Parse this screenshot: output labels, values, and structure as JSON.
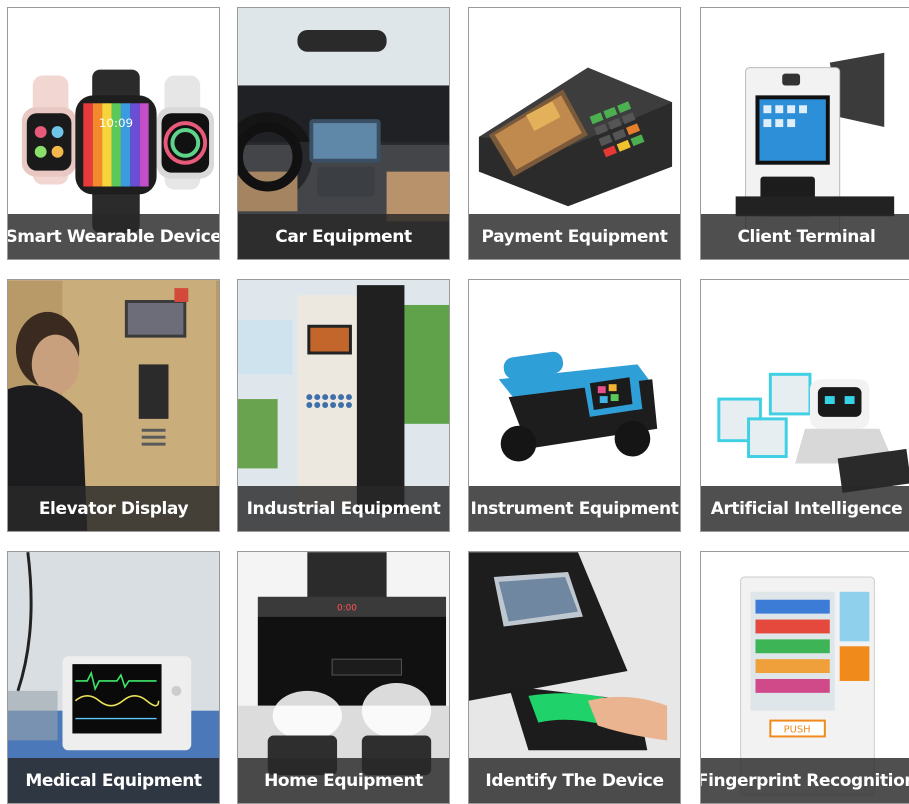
{
  "tiles": [
    {
      "label": "Smart Wearable Device",
      "icon": "smartwatch-icon"
    },
    {
      "label": "Car Equipment",
      "icon": "car-dashboard-icon"
    },
    {
      "label": "Payment Equipment",
      "icon": "pos-terminal-icon"
    },
    {
      "label": "Client Terminal",
      "icon": "kiosk-icon"
    },
    {
      "label": "Elevator Display",
      "icon": "elevator-display-icon"
    },
    {
      "label": "Industrial Equipment",
      "icon": "industrial-cabinet-icon"
    },
    {
      "label": "Instrument Equipment",
      "icon": "handheld-instrument-icon"
    },
    {
      "label": "Artificial Intelligence",
      "icon": "robot-icon"
    },
    {
      "label": "Medical Equipment",
      "icon": "patient-monitor-icon"
    },
    {
      "label": "Home Equipment",
      "icon": "range-hood-icon"
    },
    {
      "label": "Identify The Device",
      "icon": "fingerprint-scanner-icon"
    },
    {
      "label": "Fingerprint Recognition",
      "icon": "vending-machine-icon"
    }
  ],
  "screen_texts": {
    "watch_time": "10:09",
    "hood_display": "0:00",
    "vending_button": "PUSH"
  }
}
